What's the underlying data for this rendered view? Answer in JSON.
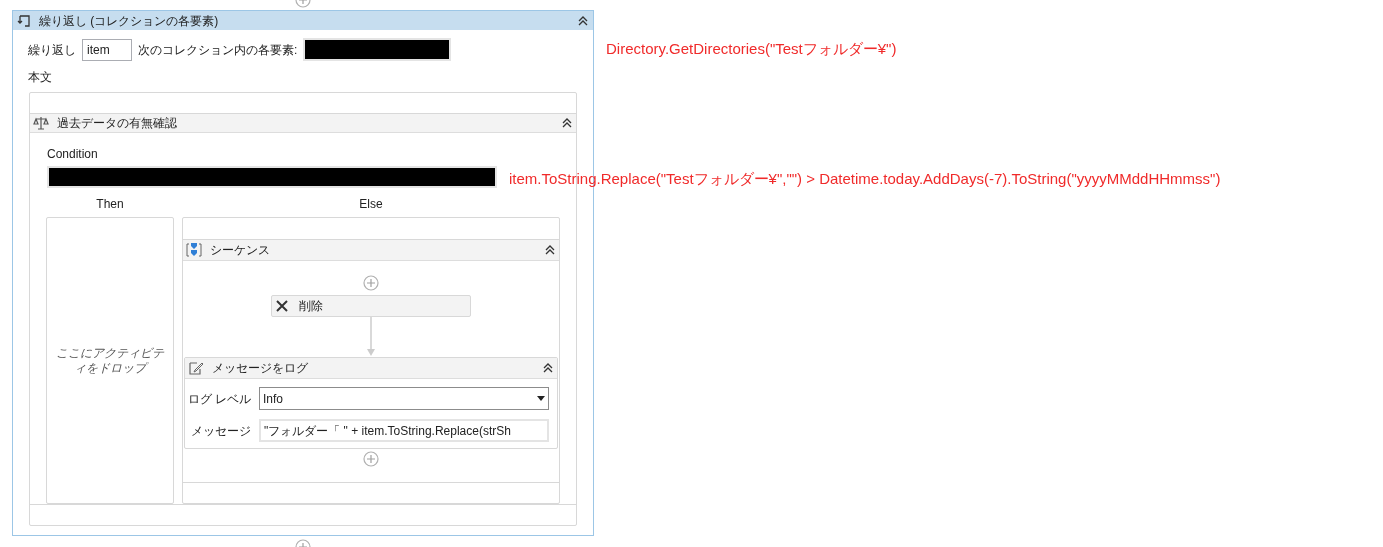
{
  "loop": {
    "title": "繰り返し (コレクションの各要素)",
    "loop_label": "繰り返し",
    "item_value": "item",
    "collection_label": "次のコレクション内の各要素:",
    "body_label": "本文"
  },
  "if": {
    "title": "過去データの有無確認",
    "condition_label": "Condition",
    "then_label": "Then",
    "else_label": "Else",
    "then_placeholder": "ここにアクティビティをドロップ"
  },
  "sequence": {
    "title": "シーケンス"
  },
  "delete": {
    "title": "削除"
  },
  "log": {
    "title": "メッセージをログ",
    "level_label": "ログ レベル",
    "level_value": "Info",
    "message_label": "メッセージ",
    "message_value": "\"フォルダー「 \" + item.ToString.Replace(strSh"
  },
  "annotations": [
    {
      "text": "Directory.GetDirectories(\"Testフォルダー¥\")"
    },
    {
      "text": "item.ToString.Replace(\"Testフォルダー¥\",\"\") > Datetime.today.AddDays(-7).ToString(\"yyyyMMddHHmmss\")"
    }
  ]
}
